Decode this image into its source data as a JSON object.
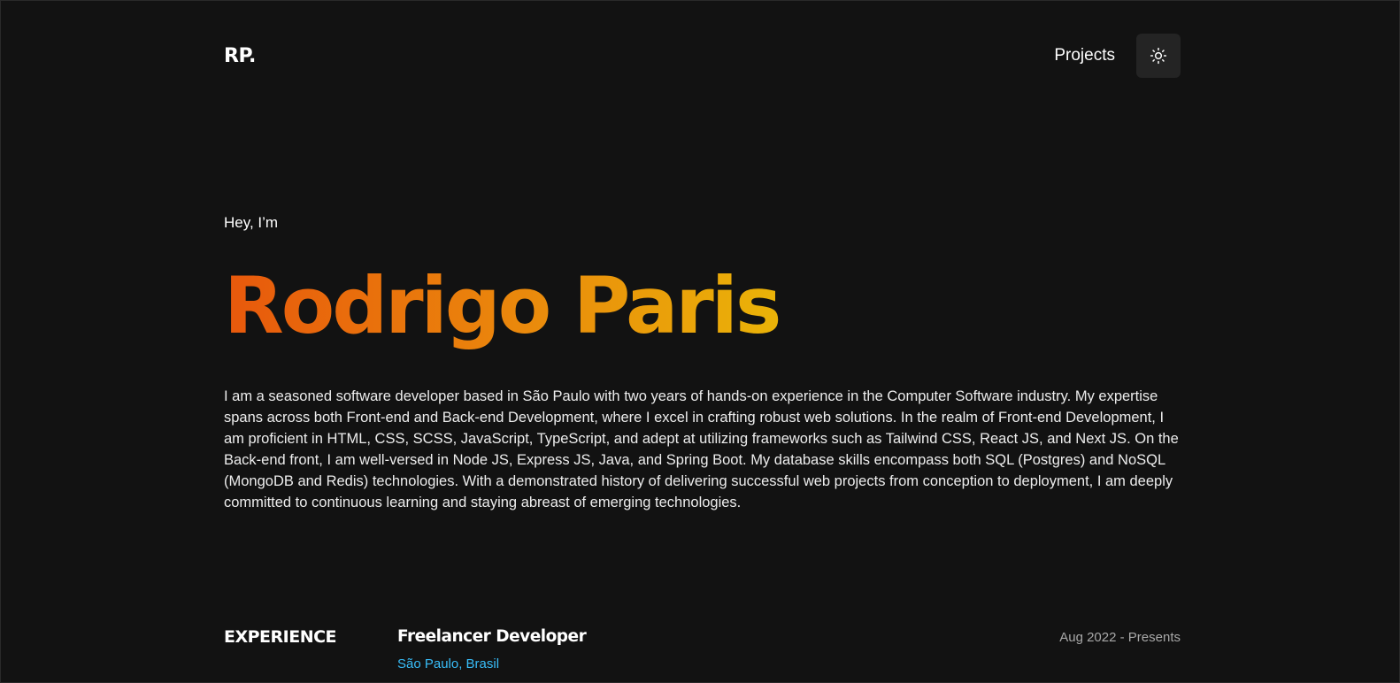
{
  "header": {
    "logo": "RP.",
    "nav_projects": "Projects",
    "theme_toggle_icon": "sun-icon"
  },
  "hero": {
    "greeting": "Hey, I’m",
    "name": "Rodrigo Paris",
    "gradient_colors": [
      "#e8580c",
      "#ea8a0c",
      "#eab308"
    ],
    "bio": "I am a seasoned software developer based in São Paulo with two years of hands-on experience in the Computer Software industry. My expertise spans across both Front-end and Back-end Development, where I excel in crafting robust web solutions. In the realm of Front-end Development, I am proficient in HTML, CSS, SCSS, JavaScript, TypeScript, and adept at utilizing frameworks such as Tailwind CSS, React JS, and Next JS. On the Back-end front, I am well-versed in Node JS, Express JS, Java, and Spring Boot. My database skills encompass both SQL (Postgres) and NoSQL (MongoDB and Redis) technologies. With a demonstrated history of delivering successful web projects from conception to deployment, I am deeply committed to continuous learning and staying abreast of emerging technologies."
  },
  "experience": {
    "section_title": "EXPERIENCE",
    "jobs": [
      {
        "title": "Freelancer Developer",
        "location": "São Paulo, Brasil",
        "date": "Aug 2022 - Presents"
      }
    ]
  },
  "colors": {
    "background": "#121212",
    "accent_link": "#38bdf8",
    "toggle_bg": "#242424"
  }
}
